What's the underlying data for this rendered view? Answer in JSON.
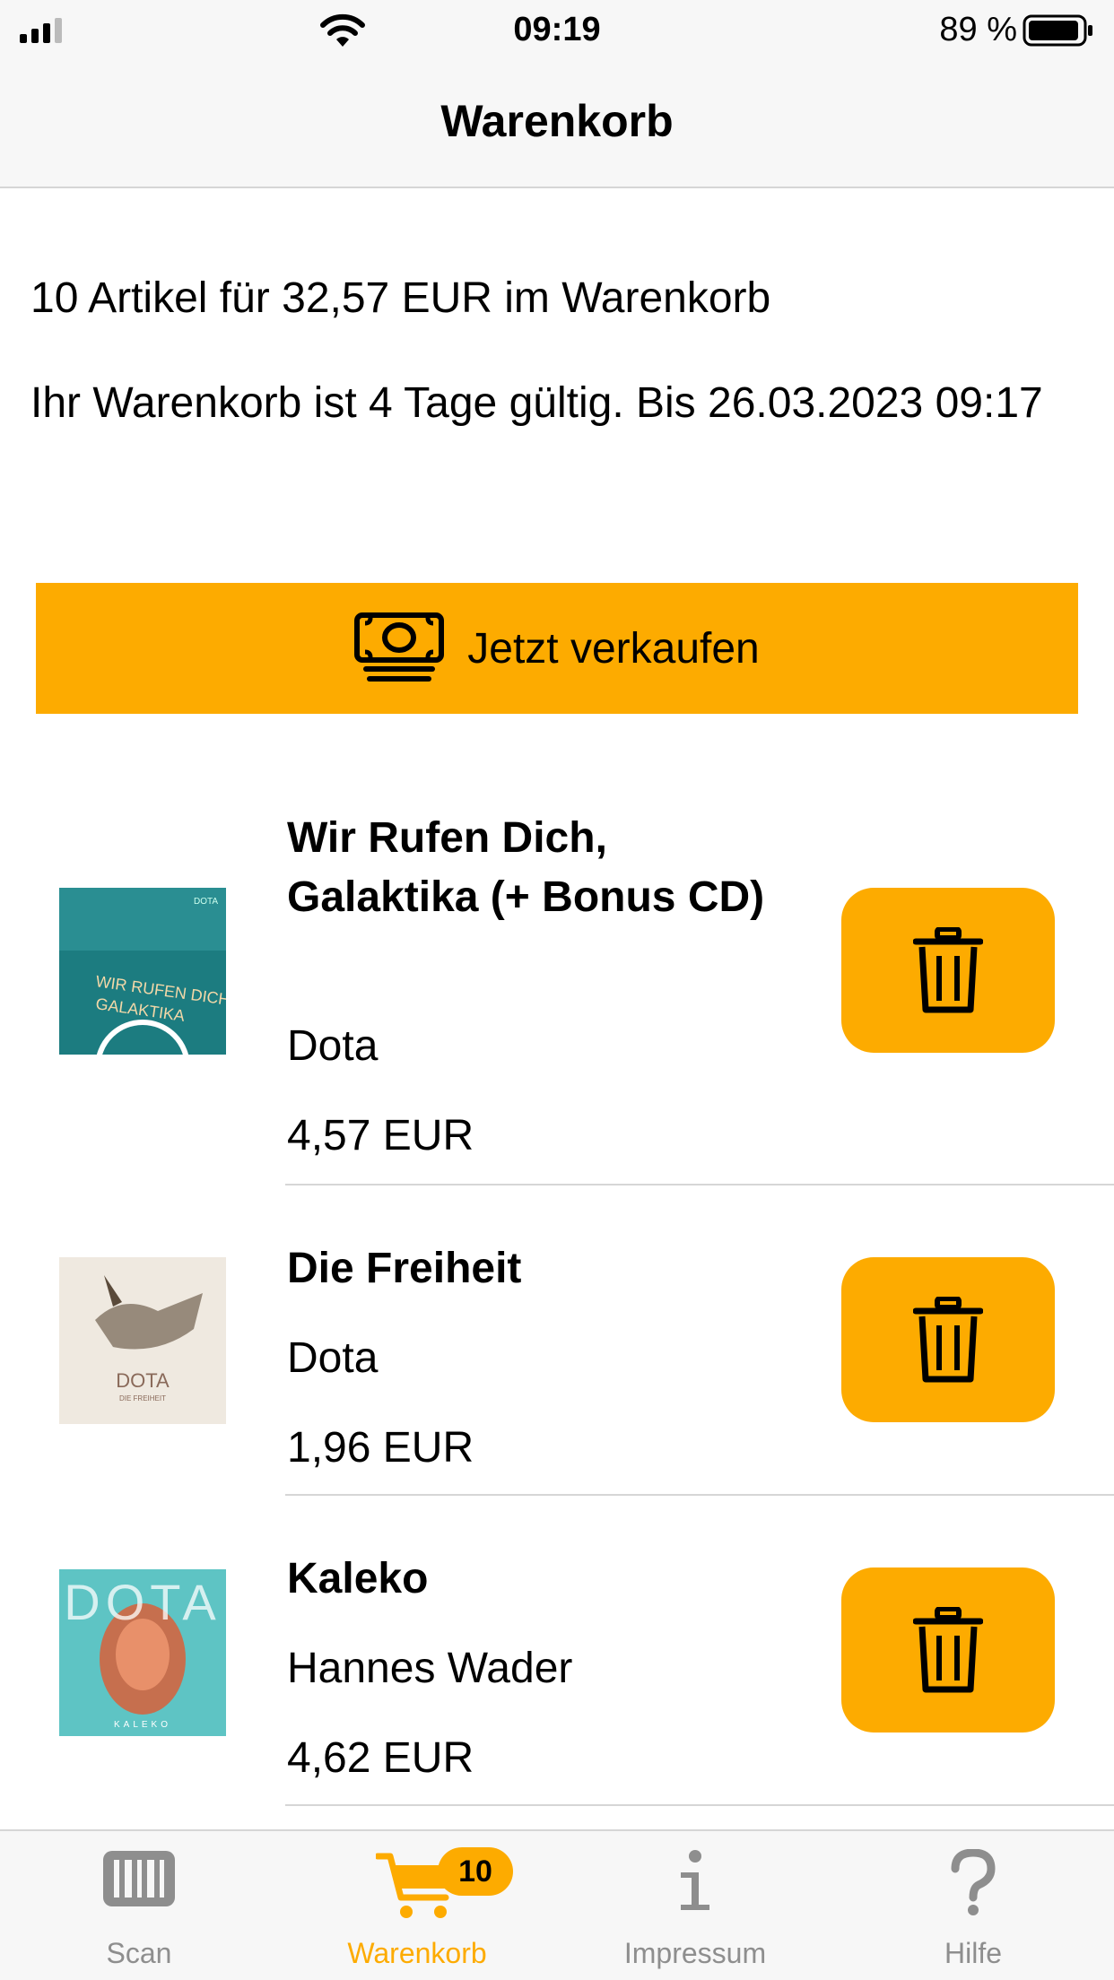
{
  "status_bar": {
    "time": "09:19",
    "battery_percent": "89 %"
  },
  "nav": {
    "title": "Warenkorb"
  },
  "summary": "10 Artikel für 32,57 EUR im Warenkorb",
  "validity": "Ihr Warenkorb ist 4 Tage gültig. Bis 26.03.2023 09:17",
  "sell_button": {
    "label": "Jetzt verkaufen",
    "icon": "money-icon"
  },
  "accent_color": "#fdab00",
  "items": [
    {
      "title": "Wir Rufen Dich, Galaktika (+ Bonus CD)",
      "artist": "Dota",
      "price": "4,57 EUR",
      "cover_color": "#1c7c80"
    },
    {
      "title": "Die Freiheit",
      "artist": "Dota",
      "price": "1,96 EUR",
      "cover_color": "#efe9e0"
    },
    {
      "title": "Kaleko",
      "artist": "Hannes Wader",
      "price": "4,62 EUR",
      "cover_color": "#5ec4c4"
    }
  ],
  "tabs": [
    {
      "label": "Scan",
      "icon": "barcode-icon",
      "active": false
    },
    {
      "label": "Warenkorb",
      "icon": "cart-icon",
      "active": true,
      "badge": "10"
    },
    {
      "label": "Impressum",
      "icon": "info-icon",
      "active": false
    },
    {
      "label": "Hilfe",
      "icon": "question-icon",
      "active": false
    }
  ]
}
